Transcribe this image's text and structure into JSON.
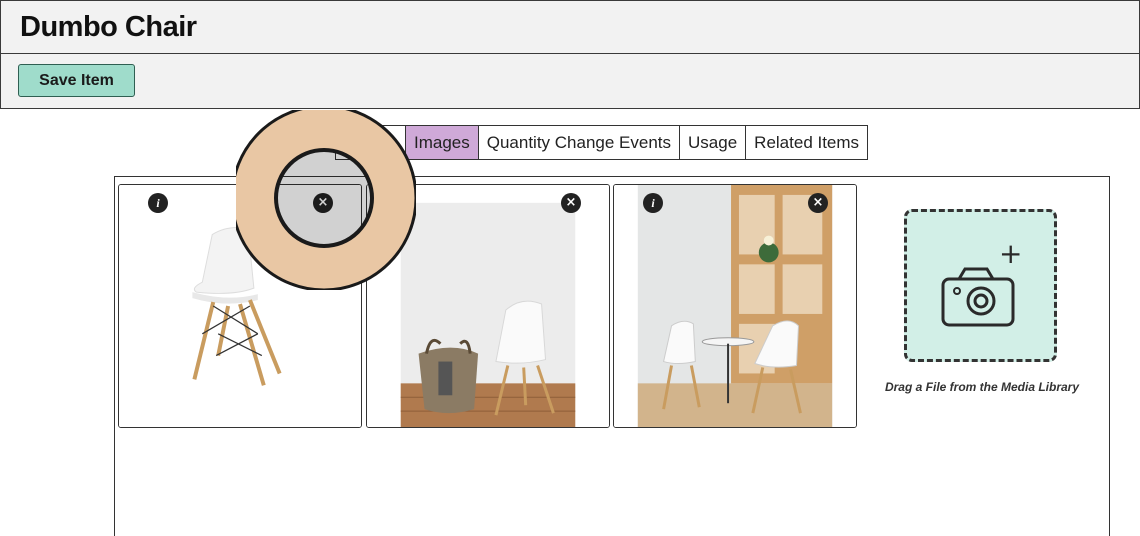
{
  "header": {
    "title": "Dumbo Chair"
  },
  "toolbar": {
    "save_label": "Save Item"
  },
  "tabs": [
    {
      "label": "",
      "active": false
    },
    {
      "label": "Images",
      "active": true
    },
    {
      "label": "Quantity Change Events",
      "active": false
    },
    {
      "label": "Usage",
      "active": false
    },
    {
      "label": "Related Items",
      "active": false
    }
  ],
  "images": [
    {
      "name": "white-chair-product",
      "has_info": true
    },
    {
      "name": "chair-with-basket",
      "has_info": false
    },
    {
      "name": "cafe-interior",
      "has_info": true
    }
  ],
  "badges": {
    "info": "i",
    "close": "×"
  },
  "upload": {
    "caption": "Drag a File from the Media Library",
    "plus": "+"
  },
  "colors": {
    "save_button": "#9fdccb",
    "active_tab": "#cfa9d8",
    "upload_bg": "#d2efe7",
    "zoom_ring": "#e9c7a4"
  }
}
